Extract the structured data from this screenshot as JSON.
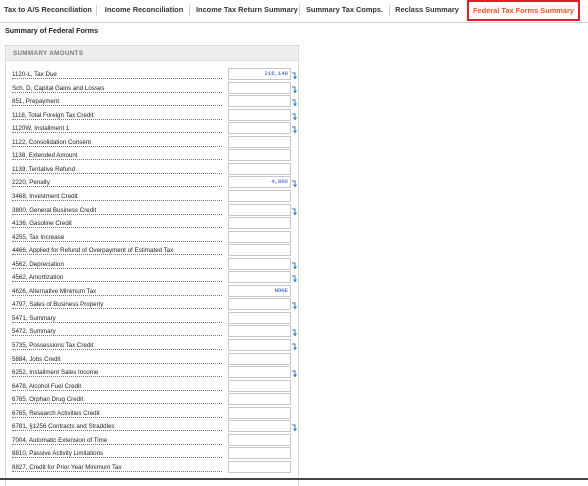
{
  "tabs": [
    {
      "label": "Tax to A/S Reconciliation",
      "active": false
    },
    {
      "label": "Income Reconciliation",
      "active": false
    },
    {
      "label": "Income Tax Return Summary",
      "active": false
    },
    {
      "label": "Summary Tax Comps.",
      "active": false
    },
    {
      "label": "Reclass Summary",
      "active": false
    },
    {
      "label": "Federal Tax Forms Summary",
      "active": true
    }
  ],
  "page_title": "Summary of Federal Forms",
  "panel": {
    "title": "SUMMARY AMOUNTS",
    "rows": [
      {
        "label": "1120-L, Tax Due",
        "value": "216,148",
        "link": true
      },
      {
        "label": "Sch. D, Capital Gains and Losses",
        "value": "",
        "link": true
      },
      {
        "label": "851, Prepayment",
        "value": "",
        "link": true
      },
      {
        "label": "1118, Total Foreign Tax Credit",
        "value": "",
        "link": true
      },
      {
        "label": "1120W, Installment 1",
        "value": "",
        "link": true
      },
      {
        "label": "1122, Consolidation Consent",
        "value": "",
        "link": false
      },
      {
        "label": "1138, Extended Amount",
        "value": "",
        "link": false
      },
      {
        "label": "1139, Tentative Refund",
        "value": "",
        "link": false
      },
      {
        "label": "2220, Penalty",
        "value": "4,806",
        "link": true
      },
      {
        "label": "3468, Investment Credit",
        "value": "",
        "link": false
      },
      {
        "label": "3800, General Business Credit",
        "value": "",
        "link": true
      },
      {
        "label": "4136, Gasoline Credit",
        "value": "",
        "link": false
      },
      {
        "label": "4255, Tax Increase",
        "value": "",
        "link": false
      },
      {
        "label": "4466, Applied for Refund of Overpayment of Estimated Tax",
        "value": "",
        "link": false
      },
      {
        "label": "4562, Depreciation",
        "value": "",
        "link": true
      },
      {
        "label": "4562, Amortization",
        "value": "",
        "link": true
      },
      {
        "label": "4626, Alternative Minimum Tax",
        "value": "NONE",
        "link": false
      },
      {
        "label": "4797, Sales of Business Property",
        "value": "",
        "link": true
      },
      {
        "label": "5471, Summary",
        "value": "",
        "link": false
      },
      {
        "label": "5472, Summary",
        "value": "",
        "link": true
      },
      {
        "label": "5735, Possessions Tax Credit",
        "value": "",
        "link": true
      },
      {
        "label": "5884, Jobs Credit",
        "value": "",
        "link": false
      },
      {
        "label": "6252, Installment Sales Income",
        "value": "",
        "link": true
      },
      {
        "label": "6478, Alcohol Fuel Credit",
        "value": "",
        "link": false
      },
      {
        "label": "6765, Orphan Drug Credit",
        "value": "",
        "link": false
      },
      {
        "label": "6765, Research Activities Credit",
        "value": "",
        "link": false
      },
      {
        "label": "6781, §1256 Contracts and Straddles",
        "value": "",
        "link": true
      },
      {
        "label": "7004, Automatic Extension of Time",
        "value": "",
        "link": false
      },
      {
        "label": "8810, Passive Activity Limitations",
        "value": "",
        "link": false
      },
      {
        "label": "8827, Credit for Prior Year Minimum Tax",
        "value": "",
        "link": false
      }
    ]
  },
  "colors": {
    "accent": "#e8541e",
    "active_border": "#e21f26",
    "value_text": "#2244cc",
    "link_icon": "#2a7bd0"
  },
  "icons": {
    "row_link": "return-arrow-icon"
  }
}
